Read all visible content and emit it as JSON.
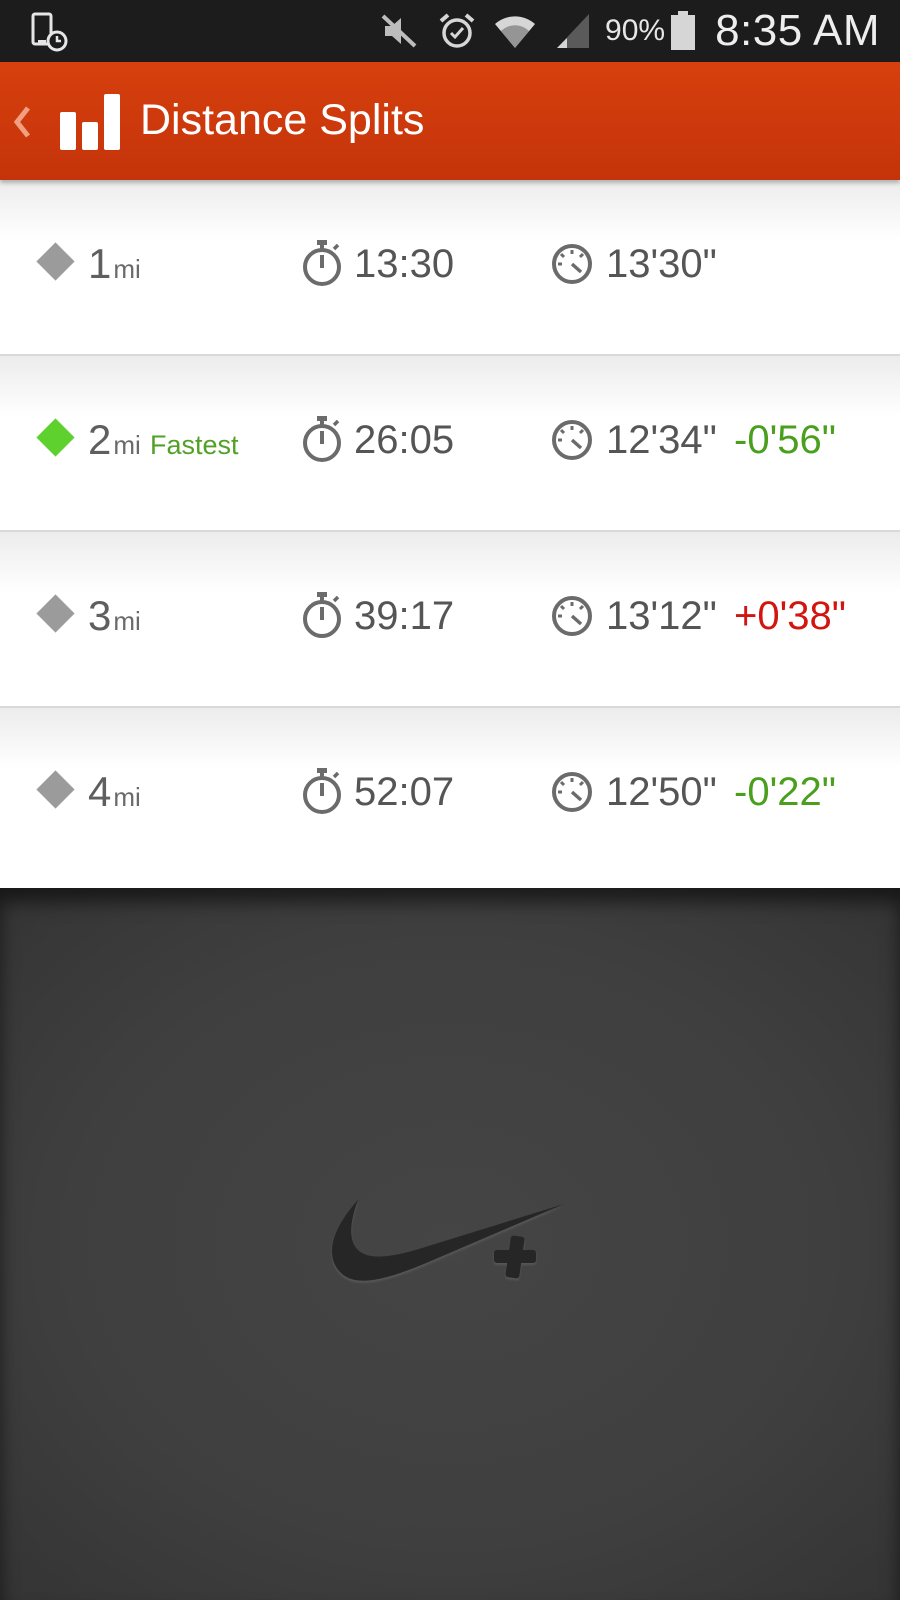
{
  "status_bar": {
    "battery": "90%",
    "time": "8:35 AM",
    "icons": [
      "device-clock-icon",
      "mute-icon",
      "alarm-icon",
      "wifi-icon",
      "signal-icon",
      "battery-icon"
    ]
  },
  "header": {
    "title": "Distance Splits",
    "accent_color": "#d13c0c"
  },
  "splits": [
    {
      "distance": "1",
      "unit": "mi",
      "fastest_label": "",
      "time": "13:30",
      "pace": "13'30\"",
      "diff": "",
      "diff_type": ""
    },
    {
      "distance": "2",
      "unit": "mi",
      "fastest_label": "Fastest",
      "time": "26:05",
      "pace": "12'34\"",
      "diff": "-0'56\"",
      "diff_type": "neg"
    },
    {
      "distance": "3",
      "unit": "mi",
      "fastest_label": "",
      "time": "39:17",
      "pace": "13'12\"",
      "diff": "+0'38\"",
      "diff_type": "pos"
    },
    {
      "distance": "4",
      "unit": "mi",
      "fastest_label": "",
      "time": "52:07",
      "pace": "12'50\"",
      "diff": "-0'22\"",
      "diff_type": "neg"
    }
  ],
  "colors": {
    "fastest_marker": "#5fd12e",
    "marker": "#9b9b9b",
    "faster": "#4a9f1c",
    "slower": "#d3150f"
  },
  "footer": {
    "logo": "swoosh-plus-logo"
  }
}
